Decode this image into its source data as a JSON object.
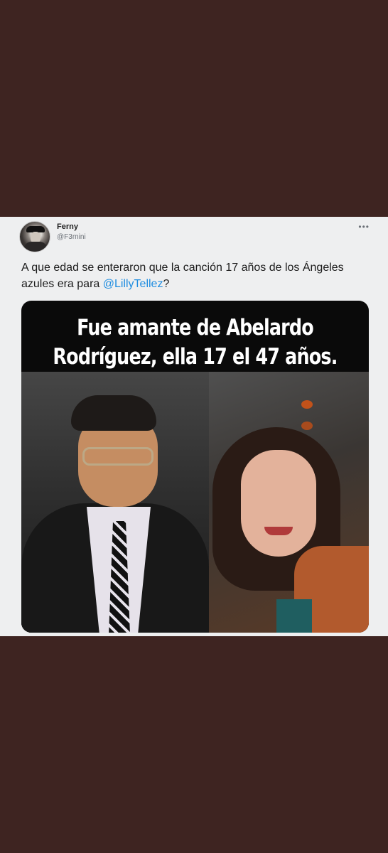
{
  "tweet": {
    "display_name": "Ferny",
    "handle": "@F3rnini",
    "more_icon": "more-options-icon",
    "text_before_mention": "A que  edad se enteraron que la canción 17 años de los Ángeles azules era para ",
    "mention": "@LillyTellez",
    "text_after_mention": "?",
    "media": {
      "caption_line1": "Fue amante de Abelardo",
      "caption_line2": "Rodríguez, ella 17 el 47 años."
    }
  },
  "colors": {
    "background": "#3e2421",
    "tweet_background": "#eeeff0",
    "mention": "#1d8ce0"
  }
}
